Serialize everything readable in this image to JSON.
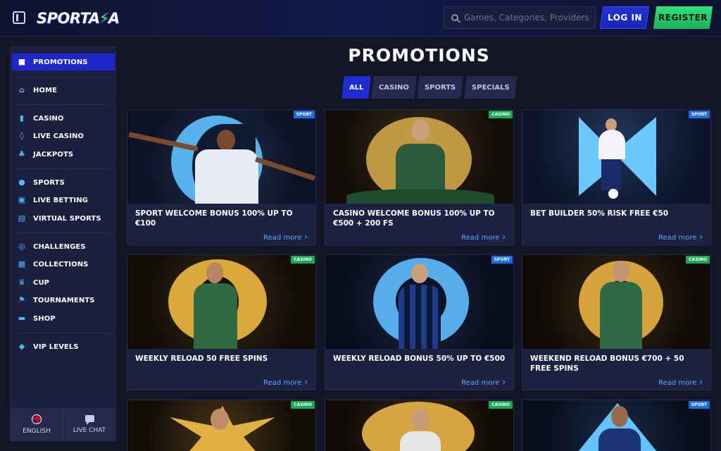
{
  "header": {
    "logo_main": "SPORTA",
    "logo_bolt": "⚡",
    "logo_end": "A",
    "search_placeholder": "Games, Categories, Providers",
    "login_label": "LOG IN",
    "register_label": "REGISTER"
  },
  "sidebar": {
    "items": [
      {
        "label": "PROMOTIONS",
        "icon": "gift-icon",
        "glyph": "🎁"
      },
      {
        "label": "HOME",
        "icon": "home-icon",
        "glyph": "⌂"
      },
      {
        "label": "CASINO",
        "icon": "slot-icon",
        "glyph": "▮"
      },
      {
        "label": "LIVE CASINO",
        "icon": "card-icon",
        "glyph": "◊"
      },
      {
        "label": "JACKPOTS",
        "icon": "clover-icon",
        "glyph": "♣"
      },
      {
        "label": "SPORTS",
        "icon": "ball-icon",
        "glyph": "⚽"
      },
      {
        "label": "LIVE BETTING",
        "icon": "live-icon",
        "glyph": "▣"
      },
      {
        "label": "VIRTUAL SPORTS",
        "icon": "virtual-icon",
        "glyph": "▤"
      },
      {
        "label": "CHALLENGES",
        "icon": "target-icon",
        "glyph": "◎"
      },
      {
        "label": "COLLECTIONS",
        "icon": "collection-icon",
        "glyph": "▦"
      },
      {
        "label": "CUP",
        "icon": "cup-icon",
        "glyph": "♛"
      },
      {
        "label": "TOURNAMENTS",
        "icon": "flag-icon",
        "glyph": "⚑"
      },
      {
        "label": "SHOP",
        "icon": "shop-icon",
        "glyph": "▬"
      },
      {
        "label": "VIP LEVELS",
        "icon": "diamond-icon",
        "glyph": "◆"
      }
    ],
    "footer": {
      "language_label": "ENGLISH",
      "chat_label": "LIVE CHAT"
    }
  },
  "main": {
    "title": "PROMOTIONS",
    "tabs": [
      "ALL",
      "CASINO",
      "SPORTS",
      "SPECIALS"
    ],
    "read_more": "Read more",
    "cards": [
      {
        "badge": "SPORT",
        "title": "SPORT WELCOME BONUS 100% UP TO €100"
      },
      {
        "badge": "CASINO",
        "title": "CASINO WELCOME BONUS 100% UP TO €500 + 200 FS"
      },
      {
        "badge": "SPORT",
        "title": "BET BUILDER 50% RISK FREE €50"
      },
      {
        "badge": "CASINO",
        "title": "WEEKLY RELOAD 50 FREE SPINS"
      },
      {
        "badge": "SPORT",
        "title": "WEEKLY RELOAD BONUS 50% UP TO €500"
      },
      {
        "badge": "CASINO",
        "title": "WEEKEND RELOAD BONUS €700 + 50 FREE SPINS"
      },
      {
        "badge": "CASINO",
        "title": ""
      },
      {
        "badge": "CASINO",
        "title": ""
      },
      {
        "badge": "SPORT",
        "title": ""
      }
    ]
  },
  "colors": {
    "accent_blue": "#1f2bd3",
    "accent_green": "#2fe07c",
    "link": "#5aa8ff",
    "sport_badge": "#1d6fe0",
    "casino_badge": "#1aa957"
  }
}
